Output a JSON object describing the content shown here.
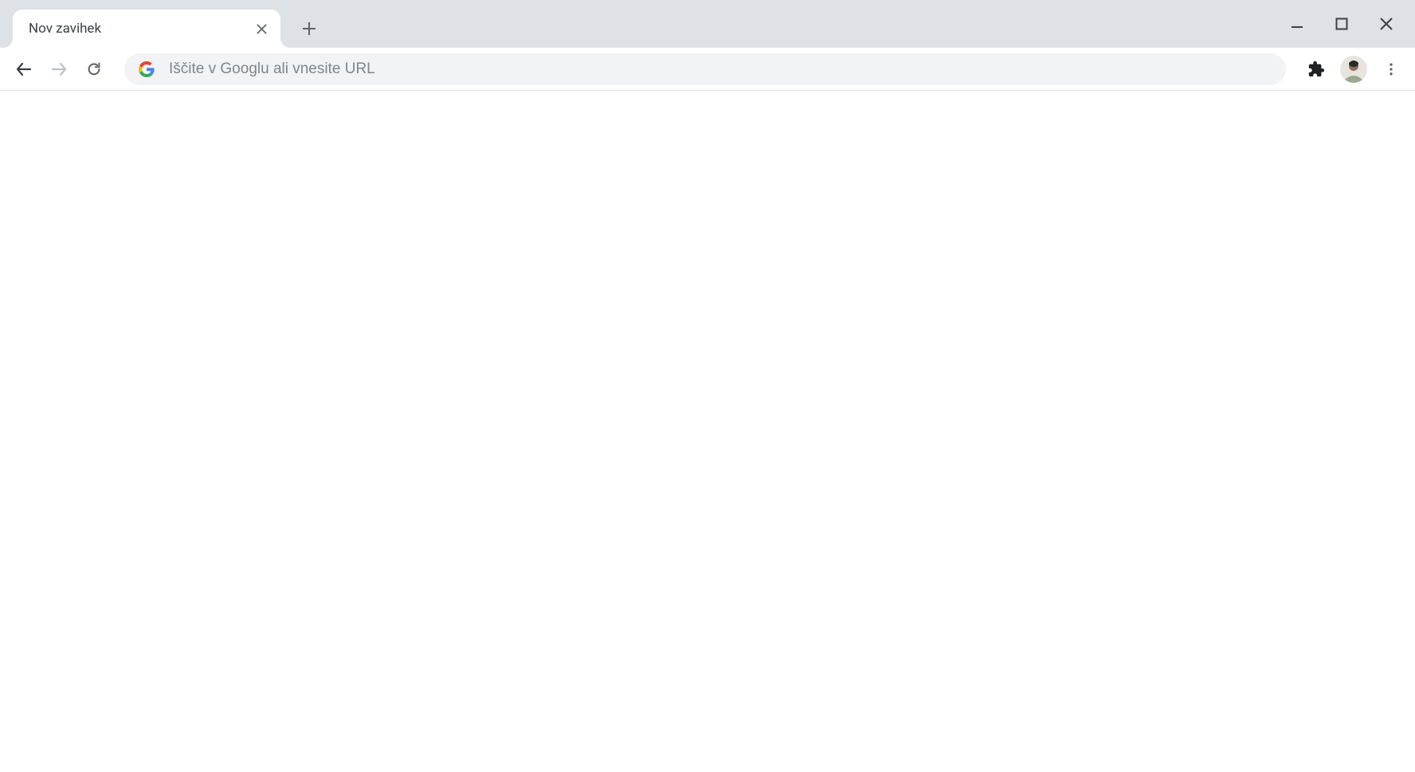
{
  "tab": {
    "title": "Nov zavihek"
  },
  "omnibox": {
    "placeholder": "Iščite v Googlu ali vnesite URL",
    "value": ""
  }
}
